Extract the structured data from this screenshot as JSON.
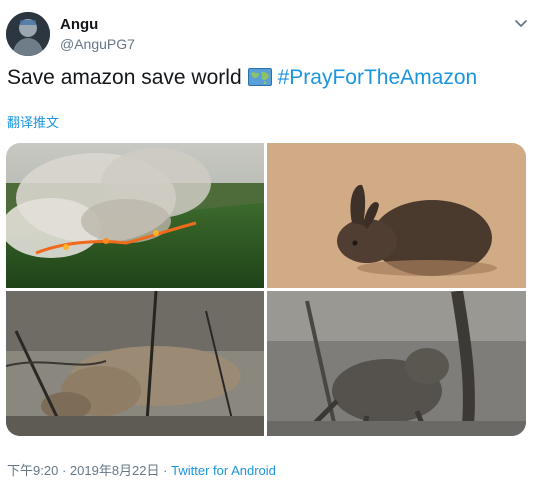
{
  "tweet": {
    "author": {
      "name": "Angu",
      "handle": "@AnguPG7"
    },
    "text": {
      "main": "Save amazon save world",
      "emoji_icon": "world-map-icon",
      "hashtag": "#PrayForTheAmazon"
    },
    "translate_label": "翻译推文",
    "media": [
      {
        "description": "amazon-fire-aerial"
      },
      {
        "description": "burned-rabbit"
      },
      {
        "description": "dead-tapir"
      },
      {
        "description": "burned-animal-on-tree"
      }
    ],
    "footer": {
      "time": "下午9:20",
      "separator": "·",
      "date": "2019年8月22日",
      "source": "Twitter for Android"
    }
  },
  "colors": {
    "link": "#1b95e0",
    "secondary_text": "#657786",
    "primary_text": "#14171a"
  }
}
